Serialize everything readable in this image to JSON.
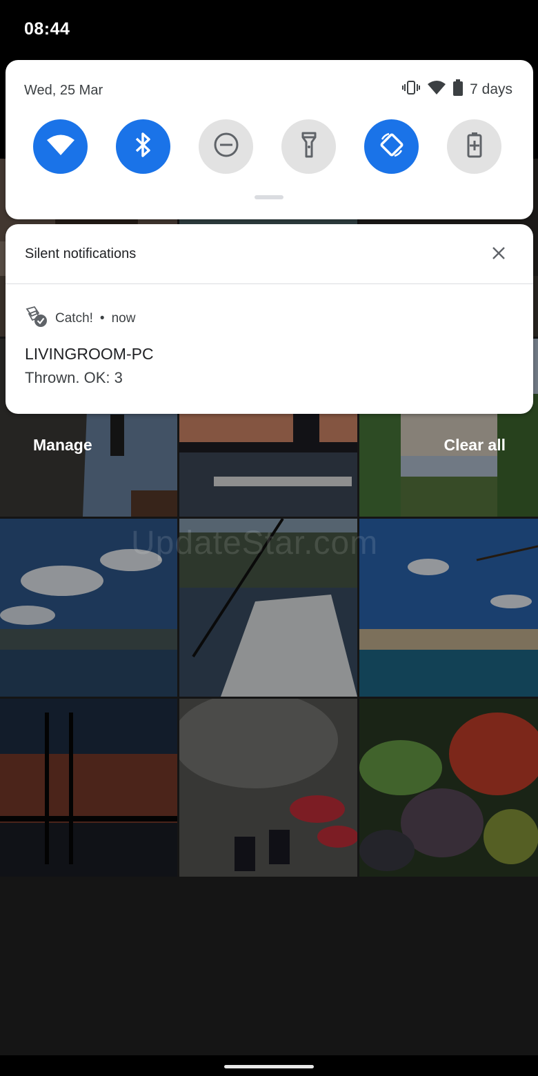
{
  "status_bar": {
    "time": "08:44"
  },
  "quick_settings": {
    "date": "Wed, 25 Mar",
    "battery_text": "7 days",
    "status_icons": [
      "vibrate-icon",
      "wifi-signal-icon",
      "battery-icon"
    ],
    "tiles": [
      {
        "name": "wifi",
        "icon": "wifi-icon",
        "state": "on"
      },
      {
        "name": "bluetooth",
        "icon": "bluetooth-icon",
        "state": "on"
      },
      {
        "name": "do-not-disturb",
        "icon": "dnd-icon",
        "state": "off"
      },
      {
        "name": "flashlight",
        "icon": "flashlight-icon",
        "state": "off"
      },
      {
        "name": "auto-rotate",
        "icon": "rotate-icon",
        "state": "on"
      },
      {
        "name": "battery-saver",
        "icon": "battery-saver-icon",
        "state": "off"
      }
    ],
    "accent_color": "#1a73e8"
  },
  "notifications": {
    "section_title": "Silent notifications",
    "items": [
      {
        "app_name": "Catch!",
        "separator": "•",
        "time": "now",
        "title": "LIVINGROOM-PC",
        "text": "Thrown. OK: 3"
      }
    ]
  },
  "actions": {
    "manage": "Manage",
    "clear_all": "Clear all"
  },
  "background": {
    "watermark": "UpdateStar.com"
  }
}
